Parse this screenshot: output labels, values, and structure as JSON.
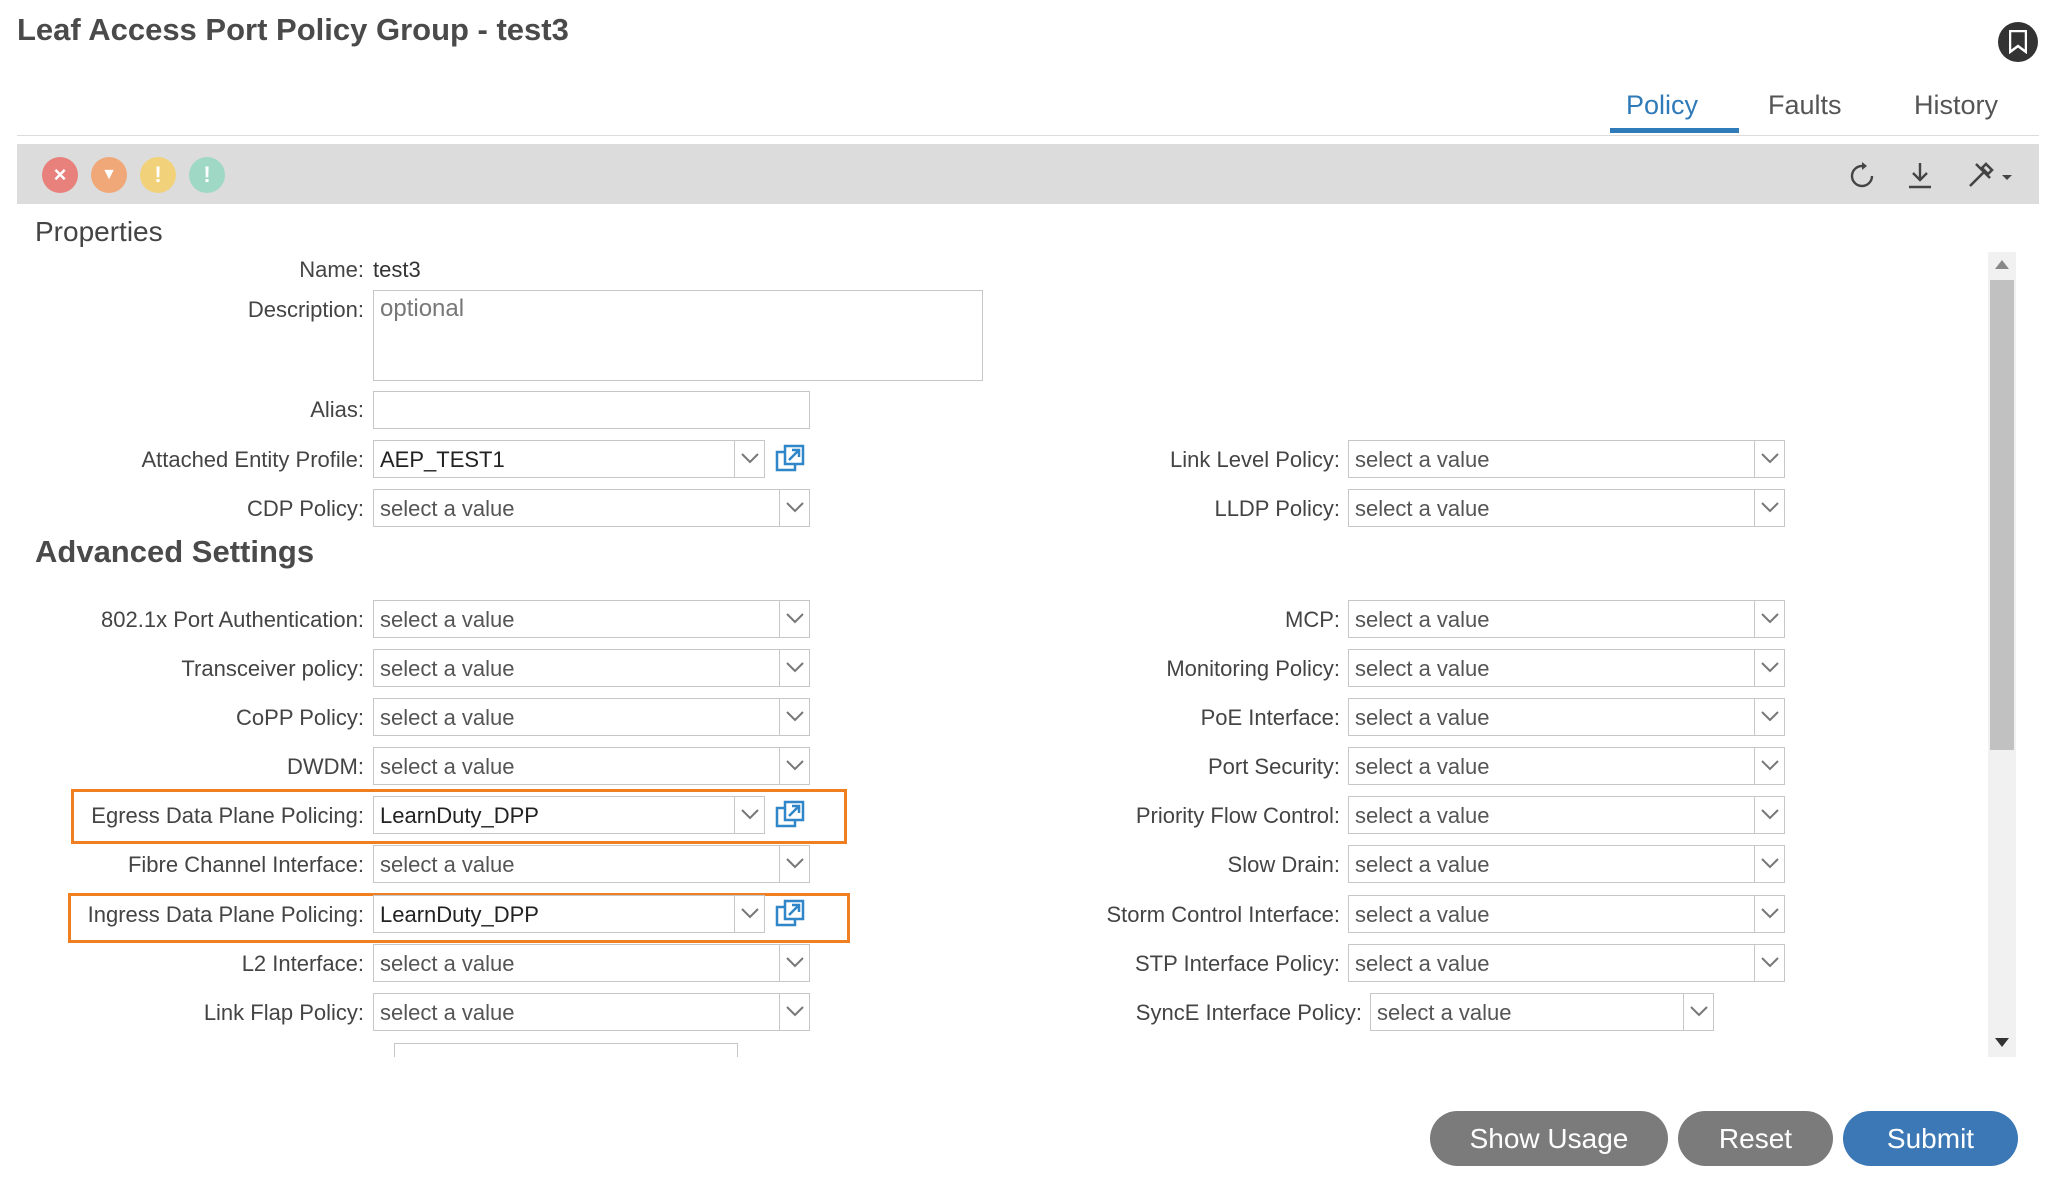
{
  "header": {
    "title": "Leaf Access Port Policy Group - test3"
  },
  "tabs": [
    {
      "label": "Policy",
      "active": true
    },
    {
      "label": "Faults",
      "active": false
    },
    {
      "label": "History",
      "active": false
    }
  ],
  "toolbar": {
    "fault_icons": [
      {
        "name": "critical-fault-icon",
        "color": "#e8807b",
        "glyph": "×"
      },
      {
        "name": "major-fault-icon",
        "color": "#f0a878",
        "glyph": "▼"
      },
      {
        "name": "minor-fault-icon",
        "color": "#f1d27a",
        "glyph": "!"
      },
      {
        "name": "warning-fault-icon",
        "color": "#9fd8c4",
        "glyph": "!"
      }
    ],
    "tools": [
      "refresh-icon",
      "download-icon",
      "tools-menu-icon"
    ]
  },
  "properties": {
    "section_title": "Properties",
    "name_label": "Name:",
    "name_value": "test3",
    "description_label": "Description:",
    "description_placeholder": "optional",
    "alias_label": "Alias:",
    "aep_label": "Attached Entity Profile:",
    "aep_value": "AEP_TEST1",
    "cdp_label": "CDP Policy:",
    "cdp_value": "select a value",
    "link_level_label": "Link Level Policy:",
    "link_level_value": "select a value",
    "lldp_label": "LLDP Policy:",
    "lldp_value": "select a value"
  },
  "advanced": {
    "section_title": "Advanced Settings",
    "left": [
      {
        "label": "802.1x Port Authentication:",
        "value": "select a value"
      },
      {
        "label": "Transceiver policy:",
        "value": "select a value"
      },
      {
        "label": "CoPP Policy:",
        "value": "select a value"
      },
      {
        "label": "DWDM:",
        "value": "select a value"
      },
      {
        "label": "Egress Data Plane Policing:",
        "value": "LearnDuty_DPP"
      },
      {
        "label": "Fibre Channel Interface:",
        "value": "select a value"
      },
      {
        "label": "Ingress Data Plane Policing:",
        "value": "LearnDuty_DPP"
      },
      {
        "label": "L2 Interface:",
        "value": "select a value"
      },
      {
        "label": "Link Flap Policy:",
        "value": "select a value"
      }
    ],
    "right": [
      {
        "label": "MCP:",
        "value": "select a value"
      },
      {
        "label": "Monitoring Policy:",
        "value": "select a value"
      },
      {
        "label": "PoE Interface:",
        "value": "select a value"
      },
      {
        "label": "Port Security:",
        "value": "select a value"
      },
      {
        "label": "Priority Flow Control:",
        "value": "select a value"
      },
      {
        "label": "Slow Drain:",
        "value": "select a value"
      },
      {
        "label": "Storm Control Interface:",
        "value": "select a value"
      },
      {
        "label": "STP Interface Policy:",
        "value": "select a value"
      },
      {
        "label": "SyncE Interface Policy:",
        "value": "select a value"
      }
    ]
  },
  "footer": {
    "show_usage": "Show Usage",
    "reset": "Reset",
    "submit": "Submit"
  },
  "colors": {
    "accent": "#2f7ab8",
    "highlight": "#f07f22",
    "secondary_button": "#7b7b7b",
    "submit_button": "#3b78b5"
  }
}
